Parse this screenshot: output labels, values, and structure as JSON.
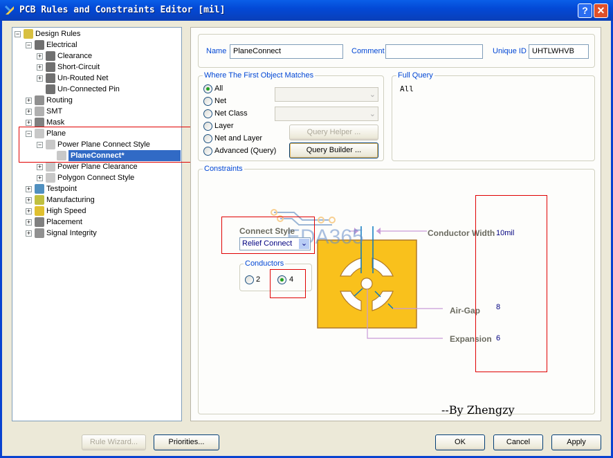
{
  "window": {
    "title": "PCB Rules and Constraints Editor [mil]",
    "help": "?",
    "close": "✕"
  },
  "tree": [
    {
      "label": "Design Rules",
      "level": 0,
      "exp": "−",
      "icon": "design-rules-icon"
    },
    {
      "label": "Electrical",
      "level": 1,
      "exp": "−",
      "icon": "electrical-icon"
    },
    {
      "label": "Clearance",
      "level": 2,
      "exp": "+",
      "icon": "electrical-icon"
    },
    {
      "label": "Short-Circuit",
      "level": 2,
      "exp": "+",
      "icon": "electrical-icon"
    },
    {
      "label": "Un-Routed Net",
      "level": 2,
      "exp": "+",
      "icon": "electrical-icon"
    },
    {
      "label": "Un-Connected Pin",
      "level": 2,
      "exp": "",
      "icon": "electrical-icon"
    },
    {
      "label": "Routing",
      "level": 1,
      "exp": "+",
      "icon": "routing-icon"
    },
    {
      "label": "SMT",
      "level": 1,
      "exp": "+",
      "icon": "smt-icon"
    },
    {
      "label": "Mask",
      "level": 1,
      "exp": "+",
      "icon": "mask-icon"
    },
    {
      "label": "Plane",
      "level": 1,
      "exp": "−",
      "icon": "plane-icon"
    },
    {
      "label": "Power Plane Connect Style",
      "level": 2,
      "exp": "−",
      "icon": "plane-icon"
    },
    {
      "label": "PlaneConnect*",
      "level": 3,
      "exp": "",
      "icon": "plane-icon",
      "selected": true
    },
    {
      "label": "Power Plane Clearance",
      "level": 2,
      "exp": "+",
      "icon": "plane-icon"
    },
    {
      "label": "Polygon Connect Style",
      "level": 2,
      "exp": "+",
      "icon": "plane-icon"
    },
    {
      "label": "Testpoint",
      "level": 1,
      "exp": "+",
      "icon": "testpoint-icon"
    },
    {
      "label": "Manufacturing",
      "level": 1,
      "exp": "+",
      "icon": "manufacturing-icon"
    },
    {
      "label": "High Speed",
      "level": 1,
      "exp": "+",
      "icon": "high-speed-icon"
    },
    {
      "label": "Placement",
      "level": 1,
      "exp": "+",
      "icon": "placement-icon"
    },
    {
      "label": "Signal Integrity",
      "level": 1,
      "exp": "+",
      "icon": "signal-integrity-icon"
    }
  ],
  "rule": {
    "name_label": "Name",
    "name": "PlaneConnect",
    "comment_label": "Comment",
    "comment": "",
    "uid_label": "Unique ID",
    "uid": "UHTLWHVB"
  },
  "match": {
    "title": "Where The First Object Matches",
    "options": [
      "All",
      "Net",
      "Net Class",
      "Layer",
      "Net and Layer",
      "Advanced (Query)"
    ],
    "selected": 0,
    "query_helper": "Query Helper ...",
    "query_builder": "Query Builder ..."
  },
  "full_query": {
    "title": "Full Query",
    "text": "All"
  },
  "constraints": {
    "title": "Constraints",
    "connect_style_label": "Connect Style",
    "connect_style": "Relief Connect",
    "conductors_label": "Conductors",
    "conductor_options": [
      "2",
      "4"
    ],
    "conductors_selected": 1,
    "conductor_width_label": "Conductor Width",
    "conductor_width": "10mil",
    "air_gap_label": "Air-Gap",
    "air_gap": "8",
    "expansion_label": "Expansion",
    "expansion": "6",
    "watermark": "EDA365",
    "signature": "--By Zhengzy",
    "pad_color": "#f9c11c"
  },
  "buttons": {
    "rule_wizard": "Rule Wizard...",
    "priorities": "Priorities...",
    "ok": "OK",
    "cancel": "Cancel",
    "apply": "Apply"
  }
}
